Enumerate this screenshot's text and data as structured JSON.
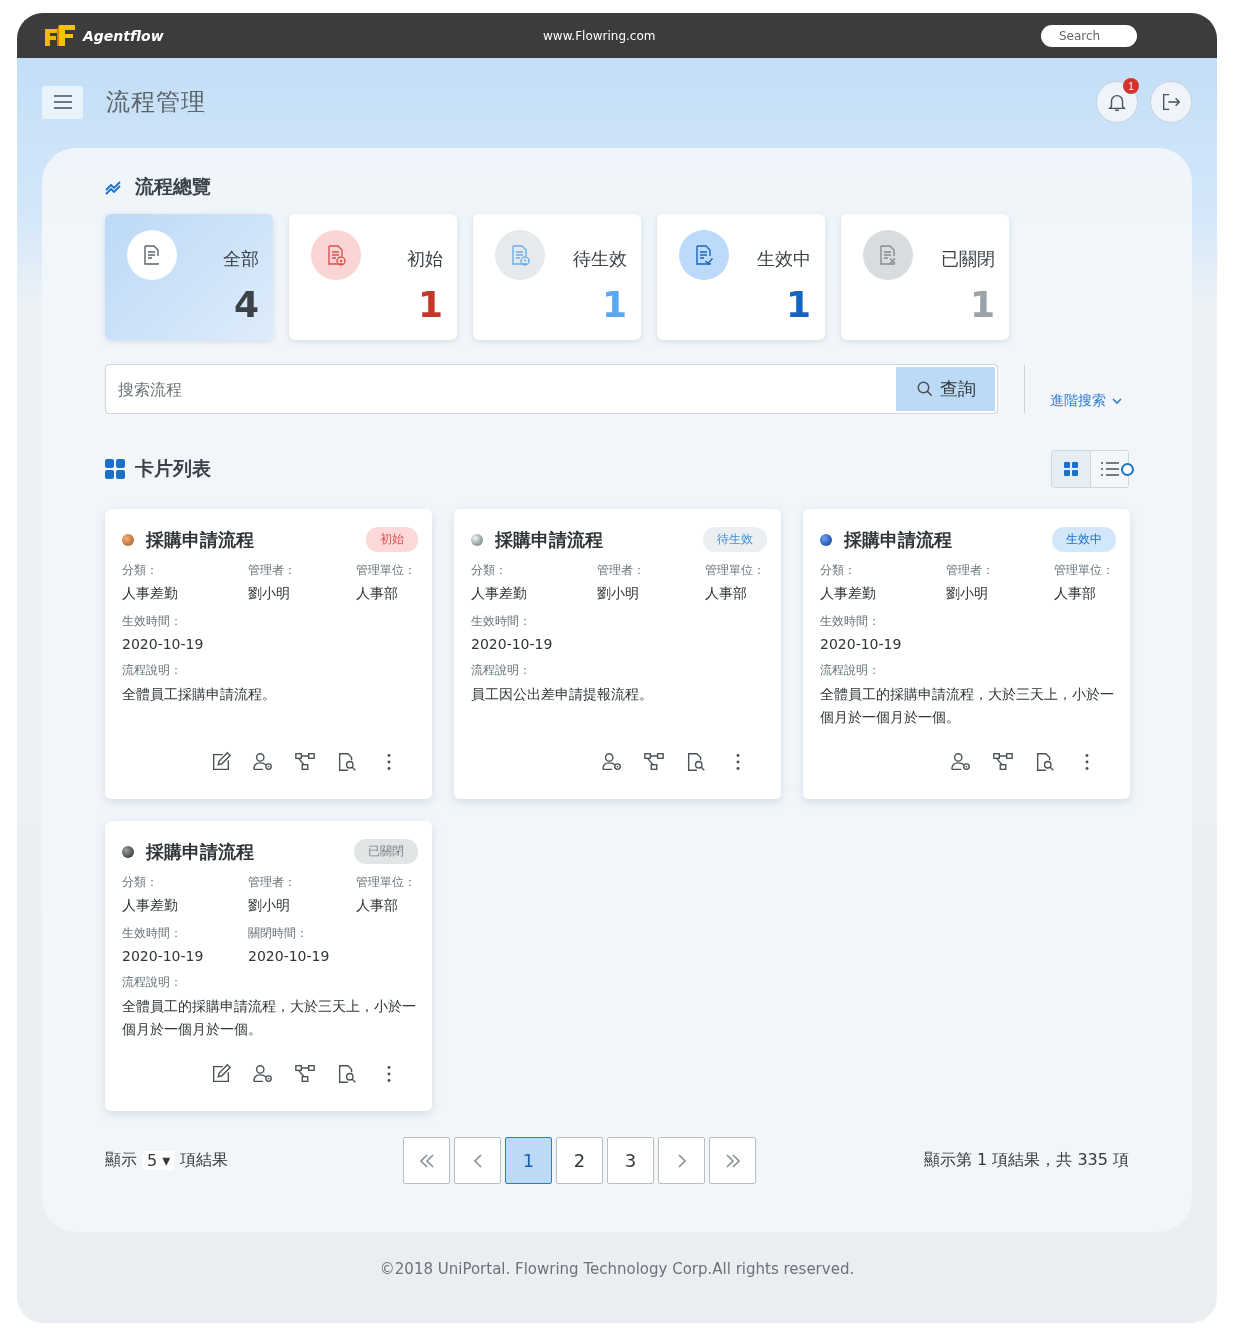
{
  "topbar": {
    "brand": "Agentflow",
    "url": "www.Flowring.com",
    "search": {
      "placeholder": "Search"
    }
  },
  "header": {
    "title": "流程管理",
    "notification_count": "1"
  },
  "overview": {
    "title": "流程總覽",
    "stats": [
      {
        "kind": "all",
        "label": "全部",
        "count": "4",
        "selected": true
      },
      {
        "kind": "initial",
        "label": "初始",
        "count": "1",
        "selected": false
      },
      {
        "kind": "pending",
        "label": "待生效",
        "count": "1",
        "selected": false
      },
      {
        "kind": "active",
        "label": "生效中",
        "count": "1",
        "selected": false
      },
      {
        "kind": "closed",
        "label": "已關閉",
        "count": "1",
        "selected": false
      }
    ]
  },
  "search": {
    "placeholder": "搜索流程",
    "button": "查詢",
    "advanced": "進階搜索"
  },
  "list": {
    "title": "卡片列表",
    "views": [
      {
        "kind": "grid",
        "selected": true
      },
      {
        "kind": "list",
        "selected": false
      }
    ]
  },
  "cards": [
    {
      "status": {
        "kind": "initial",
        "label": "初始"
      },
      "title": "採購申請流程",
      "rows": [
        [
          {
            "label": "分類：",
            "value": "人事差勤"
          },
          {
            "label": "管理者：",
            "value": "劉小明"
          },
          {
            "label": "管理單位：",
            "value": "人事部"
          }
        ],
        [
          {
            "label": "生效時間：",
            "value": "2020-10-19"
          }
        ]
      ],
      "description": {
        "label": "流程說明：",
        "text": "全體員工採購申請流程。"
      },
      "actions": [
        {
          "kind": "edit"
        },
        {
          "kind": "user-settings"
        },
        {
          "kind": "flow"
        },
        {
          "kind": "preview"
        },
        {
          "kind": "more"
        }
      ]
    },
    {
      "status": {
        "kind": "pending",
        "label": "待生效"
      },
      "title": "採購申請流程",
      "rows": [
        [
          {
            "label": "分類：",
            "value": "人事差勤"
          },
          {
            "label": "管理者：",
            "value": "劉小明"
          },
          {
            "label": "管理單位：",
            "value": "人事部"
          }
        ],
        [
          {
            "label": "生效時間：",
            "value": "2020-10-19"
          }
        ]
      ],
      "description": {
        "label": "流程說明：",
        "text": "員工因公出差申請提報流程。"
      },
      "actions": [
        {
          "kind": "user-settings"
        },
        {
          "kind": "flow"
        },
        {
          "kind": "preview"
        },
        {
          "kind": "more"
        }
      ]
    },
    {
      "status": {
        "kind": "active",
        "label": "生效中"
      },
      "title": "採購申請流程",
      "rows": [
        [
          {
            "label": "分類：",
            "value": "人事差勤"
          },
          {
            "label": "管理者：",
            "value": "劉小明"
          },
          {
            "label": "管理單位：",
            "value": "人事部"
          }
        ],
        [
          {
            "label": "生效時間：",
            "value": "2020-10-19"
          }
        ]
      ],
      "description": {
        "label": "流程說明：",
        "text": "全體員工的採購申請流程，大於三天上，小於一個月於一個月於一個。"
      },
      "actions": [
        {
          "kind": "user-settings"
        },
        {
          "kind": "flow"
        },
        {
          "kind": "preview"
        },
        {
          "kind": "more"
        }
      ]
    },
    {
      "status": {
        "kind": "closed",
        "label": "已關閉"
      },
      "title": "採購申請流程",
      "rows": [
        [
          {
            "label": "分類：",
            "value": "人事差勤"
          },
          {
            "label": "管理者：",
            "value": "劉小明"
          },
          {
            "label": "管理單位：",
            "value": "人事部"
          }
        ],
        [
          {
            "label": "生效時間：",
            "value": "2020-10-19"
          },
          {
            "label": "關閉時間：",
            "value": "2020-10-19"
          }
        ]
      ],
      "description": {
        "label": "流程說明：",
        "text": "全體員工的採購申請流程，大於三天上，小於一個月於一個月於一個。"
      },
      "actions": [
        {
          "kind": "edit"
        },
        {
          "kind": "user-settings"
        },
        {
          "kind": "flow"
        },
        {
          "kind": "preview"
        },
        {
          "kind": "more"
        }
      ]
    }
  ],
  "pagination": {
    "show_label": "顯示",
    "page_size": "5",
    "dropdown_glyph": "▾",
    "size_suffix": "項結果",
    "pages": [
      {
        "kind": "first",
        "selected": false
      },
      {
        "kind": "prev",
        "selected": false
      },
      {
        "kind": "page",
        "label": "1",
        "selected": true
      },
      {
        "kind": "page",
        "label": "2",
        "selected": false
      },
      {
        "kind": "page",
        "label": "3",
        "selected": false
      },
      {
        "kind": "next",
        "selected": false
      },
      {
        "kind": "last",
        "selected": false
      }
    ],
    "summary": "顯示第 1 項結果，共 335 項"
  },
  "footer": "©2018 UniPortal. Flowring Technology Corp.All rights reserved."
}
